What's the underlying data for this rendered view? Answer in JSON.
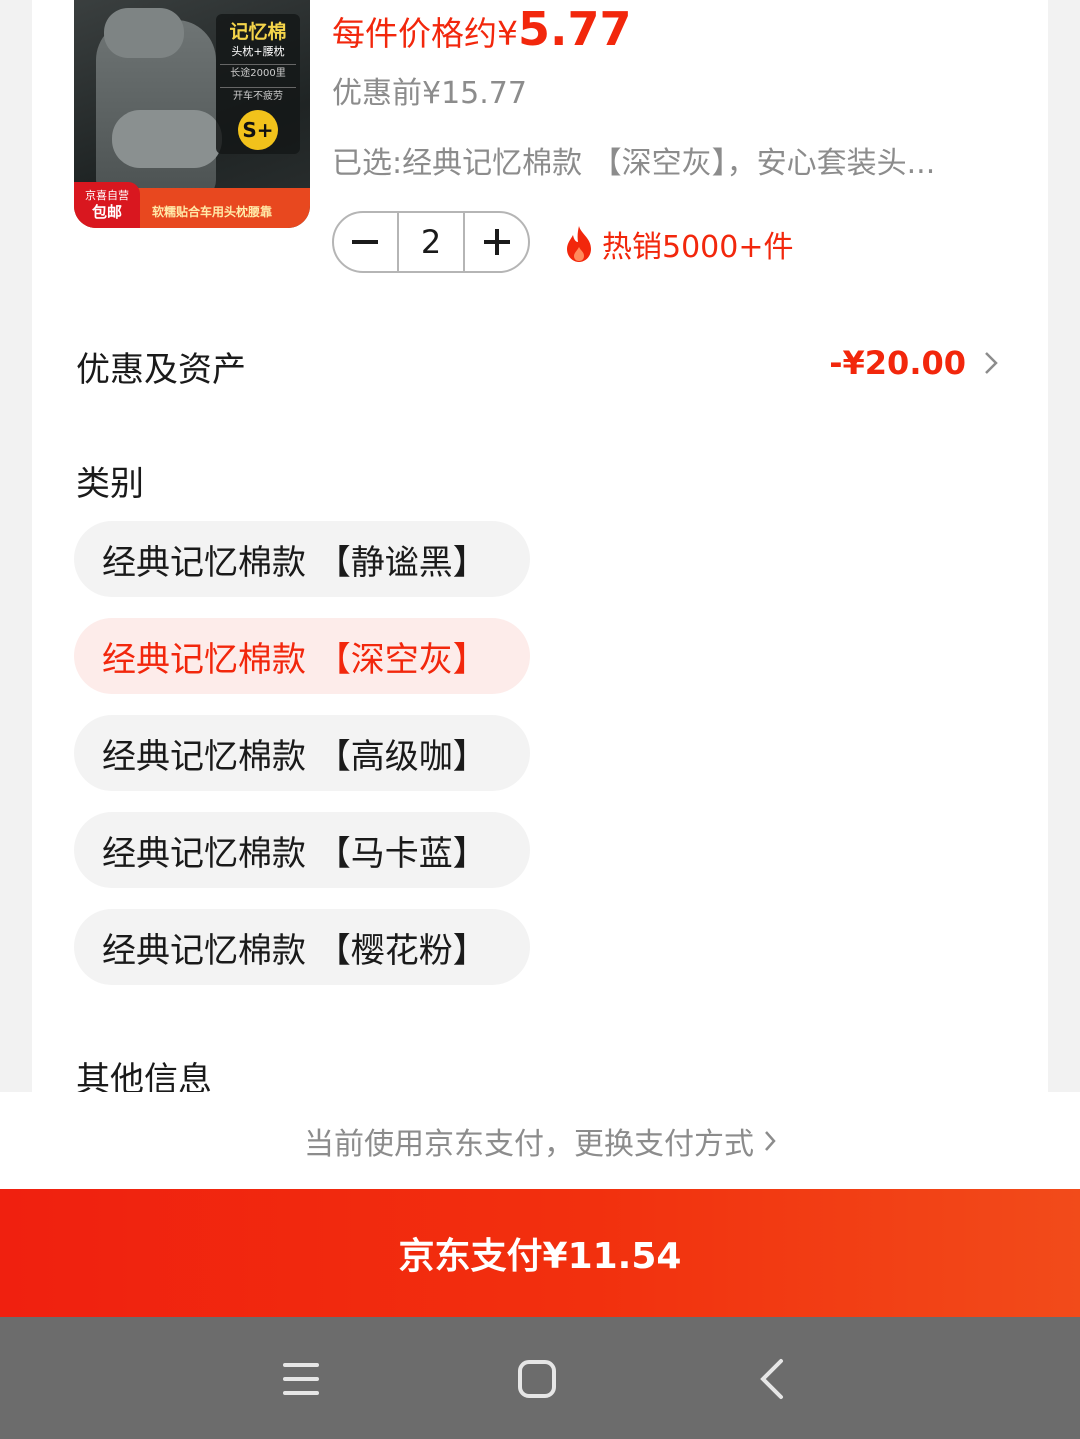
{
  "product": {
    "image_texts": {
      "title": "记忆棉",
      "subtitle": "头枕+腰枕",
      "line1": "长途2000里",
      "line2": "开车不疲劳",
      "badge": "S+",
      "tag_top": "京喜自营",
      "tag_bottom": "包邮",
      "strip": "软糯贴合车用头枕腰靠"
    },
    "price_label": "每件价格约",
    "price_currency": "¥",
    "price_value": "5.77",
    "original_price": "优惠前¥15.77",
    "selected_text": "已选:经典记忆棉款 【深空灰】，安心套装头...",
    "quantity": "2",
    "hot_text": "热销5000+件"
  },
  "discount_row": {
    "label": "优惠及资产",
    "value": "-¥20.00"
  },
  "category": {
    "label": "类别",
    "options": [
      {
        "label": "经典记忆棉款 【静谧黑】",
        "selected": false
      },
      {
        "label": "经典记忆棉款 【深空灰】",
        "selected": true
      },
      {
        "label": "经典记忆棉款 【高级咖】",
        "selected": false
      },
      {
        "label": "经典记忆棉款 【马卡蓝】",
        "selected": false
      },
      {
        "label": "经典记忆棉款 【樱花粉】",
        "selected": false
      }
    ]
  },
  "other_info": {
    "label": "其他信息"
  },
  "payment": {
    "method_text": "当前使用京东支付，更换支付方式",
    "pay_button": "京东支付¥11.54"
  },
  "colors": {
    "accent_red": "#f2270c",
    "chip_selected_bg": "#fdecea",
    "nav_bg": "#6c6c6c"
  },
  "icons": {
    "minus": "minus-icon",
    "plus": "plus-icon",
    "fire": "fire-icon",
    "chevron": "chevron-right-icon",
    "nav_menu": "menu-icon",
    "nav_home": "home-square-icon",
    "nav_back": "back-icon"
  }
}
